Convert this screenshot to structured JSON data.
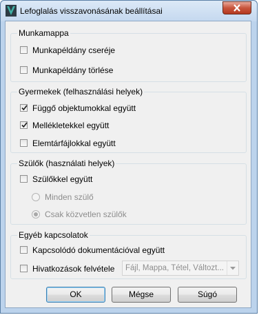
{
  "window": {
    "title": "Lefoglalás visszavonásának beállításai"
  },
  "groups": {
    "munkamappa": {
      "legend": "Munkamappa",
      "items": [
        {
          "label": "Munkapéldány cseréje",
          "checked": false
        },
        {
          "label": "Munkapéldány törlése",
          "checked": false
        }
      ]
    },
    "gyermekek": {
      "legend": "Gyermekek (felhasználási helyek)",
      "items": [
        {
          "label": "Függő objektumokkal együtt",
          "checked": true
        },
        {
          "label": "Mellékletekkel együtt",
          "checked": true
        },
        {
          "label": "Elemtárfájlokkal együtt",
          "checked": false
        }
      ]
    },
    "szulok": {
      "legend": "Szülők (használati helyek)",
      "checkbox": {
        "label": "Szülőkkel együtt",
        "checked": false
      },
      "radios": [
        {
          "label": "Minden szülő",
          "selected": false,
          "enabled": false
        },
        {
          "label": "Csak közvetlen szülők",
          "selected": true,
          "enabled": false
        }
      ]
    },
    "egyeb": {
      "legend": "Egyéb kapcsolatok",
      "items": [
        {
          "label": "Kapcsolódó dokumentációval együtt",
          "checked": false
        },
        {
          "label": "Hivatkozások felvétele",
          "checked": false
        }
      ],
      "combo_value": "Fájl, Mappa, Tétel, Változt..."
    }
  },
  "buttons": {
    "ok": "OK",
    "cancel": "Mégse",
    "help": "Súgó"
  }
}
